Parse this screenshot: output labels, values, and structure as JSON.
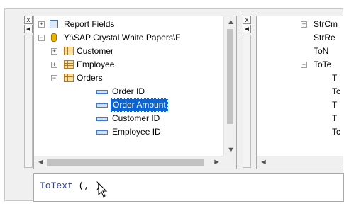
{
  "left_tree": {
    "items": [
      {
        "label": "Report Fields",
        "expander": "+",
        "icon": "report-fields-icon"
      },
      {
        "label": "Y:\\SAP Crystal White Papers\\F",
        "expander": "−",
        "icon": "database-icon"
      },
      {
        "label": "Customer",
        "expander": "+",
        "icon": "table-icon"
      },
      {
        "label": "Employee",
        "expander": "+",
        "icon": "table-icon"
      },
      {
        "label": "Orders",
        "expander": "−",
        "icon": "table-icon"
      },
      {
        "label": "Order ID",
        "icon": "field-icon"
      },
      {
        "label": "Order Amount",
        "icon": "field-icon",
        "selected": true
      },
      {
        "label": "Customer ID",
        "icon": "field-icon"
      },
      {
        "label": "Employee ID",
        "icon": "field-icon"
      }
    ]
  },
  "right_tree": {
    "items": [
      {
        "label": "StrCm",
        "expander": "+"
      },
      {
        "label": "StrRe"
      },
      {
        "label": "ToN"
      },
      {
        "label": "ToTe",
        "expander": "−"
      },
      {
        "label": "T"
      },
      {
        "label": "Tc"
      },
      {
        "label": "T"
      },
      {
        "label": "T"
      },
      {
        "label": "Tc"
      }
    ]
  },
  "editor": {
    "keyword": "ToText",
    "args": " (, )"
  },
  "side_buttons": {
    "close": "x",
    "pin": "◄"
  },
  "colors": {
    "selection": "#0a64d2",
    "keyword": "#1f3fbf"
  }
}
